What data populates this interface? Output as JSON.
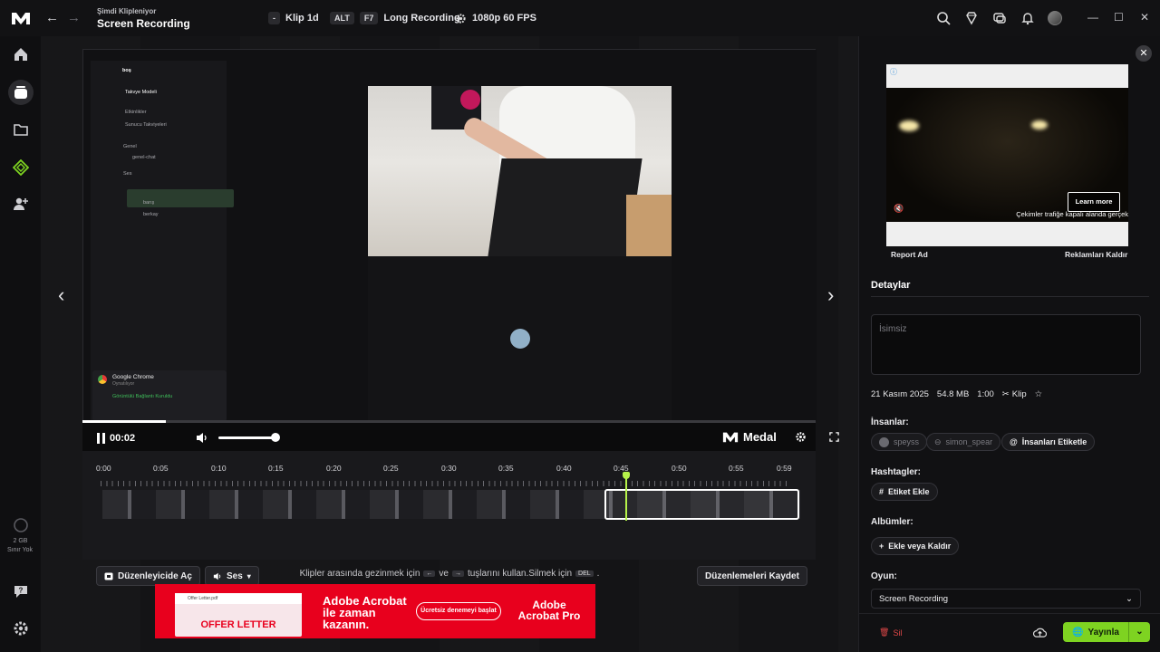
{
  "topbar": {
    "subtitle": "Şimdi Klipleniyor",
    "title": "Screen Recording",
    "dash": "-",
    "clip_label": "Klip 1d",
    "alt_key": "ALT",
    "f7_key": "F7",
    "long_rec": "Long Recording",
    "quality": "1080p 60 FPS"
  },
  "sidebar": {
    "storage_value": "2 GB",
    "storage_limit": "Sınır Yok"
  },
  "discord": {
    "server": "boş",
    "items": [
      "Takvye Modeli",
      "Etkinlikler",
      "Sunucu Takviyeleri",
      "Genel",
      "genel-chat",
      "Ses"
    ],
    "voice_users": [
      "barış",
      "berkay"
    ],
    "chrome_title": "Google Chrome",
    "chrome_sub": "Oynatılıyor",
    "voice_status": "Görüntülü Bağlantı Kuruldu"
  },
  "player": {
    "time": "00:02",
    "brand": "Medal"
  },
  "timeline": {
    "ticks": [
      "0:00",
      "0:05",
      "0:10",
      "0:15",
      "0:20",
      "0:25",
      "0:30",
      "0:35",
      "0:40",
      "0:45",
      "0:50",
      "0:55",
      "0:59"
    ],
    "open_editor": "Düzenleyicide Aç",
    "audio": "Ses",
    "save_edits": "Düzenlemeleri Kaydet"
  },
  "hint": {
    "pre": "Klipler arasında gezinmek için",
    "mid": "ve",
    "post": "tuşlarını kullan.Silmek için",
    "del": "DEL",
    "end": "."
  },
  "ad_banner": {
    "doc_name": "Offer Letter.pdf",
    "doc_title": "OFFER LETTER",
    "headline": "Adobe Acrobat ile zaman kazanın.",
    "cta": "Ücretsiz denemeyi başlat",
    "brand": "Adobe Acrobat Pro"
  },
  "right": {
    "ad_learn": "Learn more",
    "ad_caption": "Çekimler trafiğe kapalı alanda gerçek",
    "report_ad": "Report Ad",
    "remove_ads": "Reklamları Kaldır",
    "details_tab": "Detaylar",
    "name_placeholder": "İsimsiz",
    "date": "21 Kasım 2025",
    "size": "54.8 MB",
    "duration": "1:00",
    "type": "Klip",
    "people_h": "İnsanlar:",
    "people": [
      "speyss",
      "simon_spear"
    ],
    "tag_people": "İnsanları Etiketle",
    "hashtags_h": "Hashtagler:",
    "add_tag": "Etiket Ekle",
    "albums_h": "Albümler:",
    "add_album": "Ekle veya Kaldır",
    "game_h": "Oyun:",
    "game": "Screen Recording",
    "delete": "Sil",
    "publish": "Yayınla"
  }
}
